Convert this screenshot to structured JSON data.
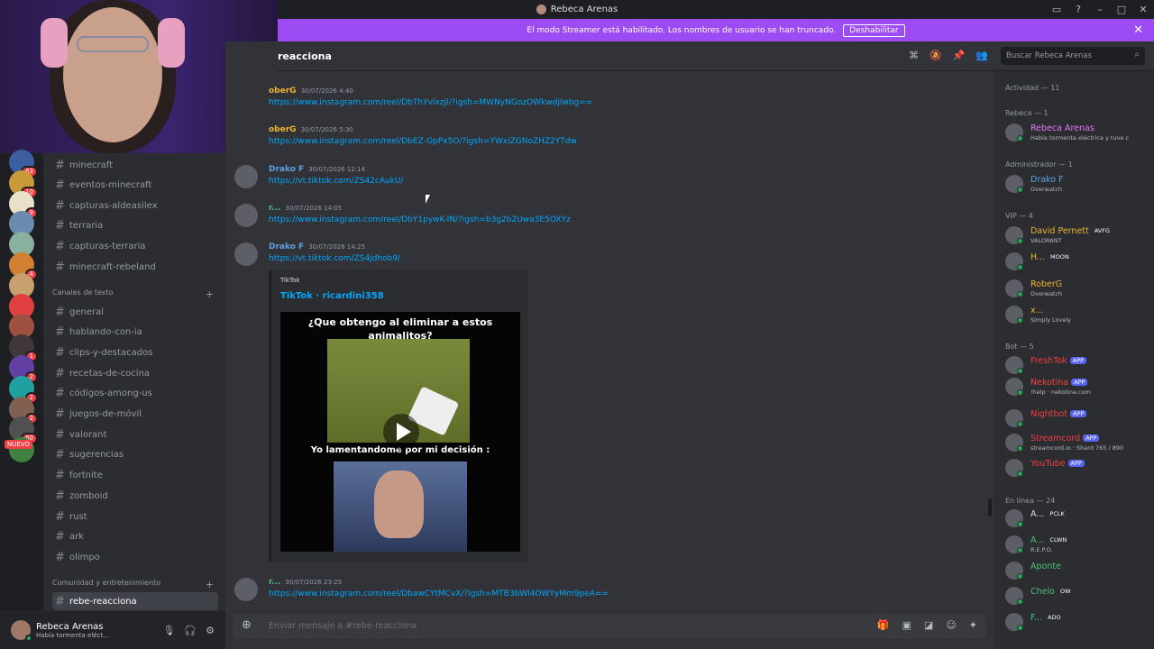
{
  "window": {
    "title": "Rebeca Arenas"
  },
  "banner": {
    "text": "El modo Streamer está habilitado. Los nombres de usuario se han truncado.",
    "button": "Deshabilitar"
  },
  "servers": [
    {
      "badge": "63",
      "color": "#3b5fa0"
    },
    {
      "badge": "10",
      "color": "#c89a3a"
    },
    {
      "badge": "9",
      "color": "#e8e0c8"
    },
    {
      "badge": "",
      "color": "#6a8ab0"
    },
    {
      "badge": "",
      "color": "#8ab0a0"
    },
    {
      "badge": "4",
      "color": "#d08030"
    },
    {
      "badge": "",
      "color": "#c8a070"
    },
    {
      "badge": "",
      "color": "#e04040"
    },
    {
      "badge": "",
      "color": "#a05040"
    },
    {
      "badge": "1",
      "color": "#403838"
    },
    {
      "badge": "2",
      "color": "#6040a0"
    },
    {
      "badge": "2",
      "color": "#20a0a0"
    },
    {
      "badge": "2",
      "color": "#806050"
    },
    {
      "badge": "60",
      "color": "#505050"
    },
    {
      "badge": "",
      "color": "#408040"
    }
  ],
  "new_label": "NUEVO",
  "channels": {
    "top": [
      "minecraft",
      "eventos-minecraft",
      "capturas-aldeasilex",
      "terraria",
      "capturas-terraria",
      "minecraft-rebeland"
    ],
    "cat_text": "Canales de texto",
    "text": [
      "general",
      "hablando-con-ia",
      "clips-y-destacados",
      "recetas-de-cocina",
      "códigos-among-us",
      "juegos-de-móvil",
      "valorant",
      "sugerencias",
      "fortnite",
      "zomboid",
      "rust",
      "ark",
      "olimpo"
    ],
    "cat_community": "Comunidad y entretenimiento",
    "active": "rebe-reacciona"
  },
  "user": {
    "name": "Rebeca Arenas",
    "status": "Había tormenta eléct..."
  },
  "header": {
    "channel": "reacciona",
    "search_placeholder": "Buscar Rebeca Arenas"
  },
  "messages": [
    {
      "name": "oberG",
      "color": "#f0b232",
      "time": "30/07/2026 4:40",
      "link": "https://www.instagram.com/reel/DbThYvlxzjl/?igsh=MWNyNGozOWkwdjlwbg=="
    },
    {
      "name": "oberG",
      "color": "#f0b232",
      "time": "30/07/2026 5:30",
      "link": "https://www.instagram.com/reel/DbEZ-GpPx5O/?igsh=YWxiZGNoZHZ2YTdw"
    },
    {
      "name": "Drako F",
      "color": "#60a0e0",
      "time": "30/07/2026 12:14",
      "link": "https://vt.tiktok.com/ZS42cAukU/"
    },
    {
      "name": "r...",
      "color": "#4ec07a",
      "time": "30/07/2026 14:05",
      "link": "https://www.instagram.com/reel/DbY1pywK-lN/?igsh=b3g2b2Uwa3E5OXYz"
    },
    {
      "name": "Drako F",
      "color": "#60a0e0",
      "time": "30/07/2026 14:25",
      "link": "https://vt.tiktok.com/ZS4jdhob9/"
    },
    {
      "name": "r...",
      "color": "#4ec07a",
      "time": "30/07/2026 23:25",
      "link": "https://www.instagram.com/reel/DbawCYtMCvX/?igsh=MTB3bWl4OWYyMm9peA=="
    }
  ],
  "embed": {
    "provider": "TikTok",
    "title": "TikTok · ricardini358",
    "caption_top": "¿Que obtengo al eliminar a estos animalitos?",
    "caption_mid": "Yo lamentandome por mi decisión :"
  },
  "composer": {
    "placeholder": "Enviar mensaje a #rebe-reacciona"
  },
  "members": {
    "activity": "Actividad — 11",
    "groups": [
      {
        "title": "Rebeca — 1",
        "items": [
          {
            "name": "Rebeca Arenas",
            "color": "#e879f9",
            "status": "Había tormenta eléctrica y tuve c"
          }
        ]
      },
      {
        "title": "Administrador — 1",
        "items": [
          {
            "name": "Drako F",
            "color": "#60a0e0",
            "status": "Overwatch"
          }
        ]
      },
      {
        "title": "VIP — 4",
        "items": [
          {
            "name": "David Pernett",
            "color": "#f0b232",
            "status": "VALORANT",
            "tag": "AVFG"
          },
          {
            "name": "H...",
            "color": "#f0b232",
            "status": "",
            "tag": "MOON"
          },
          {
            "name": "RoberG",
            "color": "#f0b232",
            "status": "Overwatch"
          },
          {
            "name": "x...",
            "color": "#f0b232",
            "status": "Simply Lovely"
          }
        ]
      },
      {
        "title": "Bot — 5",
        "items": [
          {
            "name": "FreshTok",
            "color": "#f23f43",
            "status": "",
            "tag": "APP"
          },
          {
            "name": "Nekotina",
            "color": "#f23f43",
            "status": "!help · nekotina.com",
            "tag": "APP"
          },
          {
            "name": "Nightbot",
            "color": "#f23f43",
            "status": "",
            "tag": "APP"
          },
          {
            "name": "Streamcord",
            "color": "#f23f43",
            "status": "streamcord.io · Shard 765 / 890",
            "tag": "APP"
          },
          {
            "name": "YouTube",
            "color": "#f23f43",
            "status": "",
            "tag": "APP"
          }
        ]
      },
      {
        "title": "En línea — 24",
        "items": [
          {
            "name": "A...",
            "color": "#dbdee1",
            "status": "",
            "tag": "PCLK"
          },
          {
            "name": "A...",
            "color": "#4ec07a",
            "status": "R.E.P.O.",
            "tag": "CLWN"
          },
          {
            "name": "Aponte",
            "color": "#4ec07a",
            "status": ""
          },
          {
            "name": "Chelo",
            "color": "#4ec07a",
            "status": "",
            "tag": "OW"
          },
          {
            "name": "F...",
            "color": "#4ec07a",
            "status": "",
            "tag": "ADO"
          }
        ]
      }
    ]
  }
}
